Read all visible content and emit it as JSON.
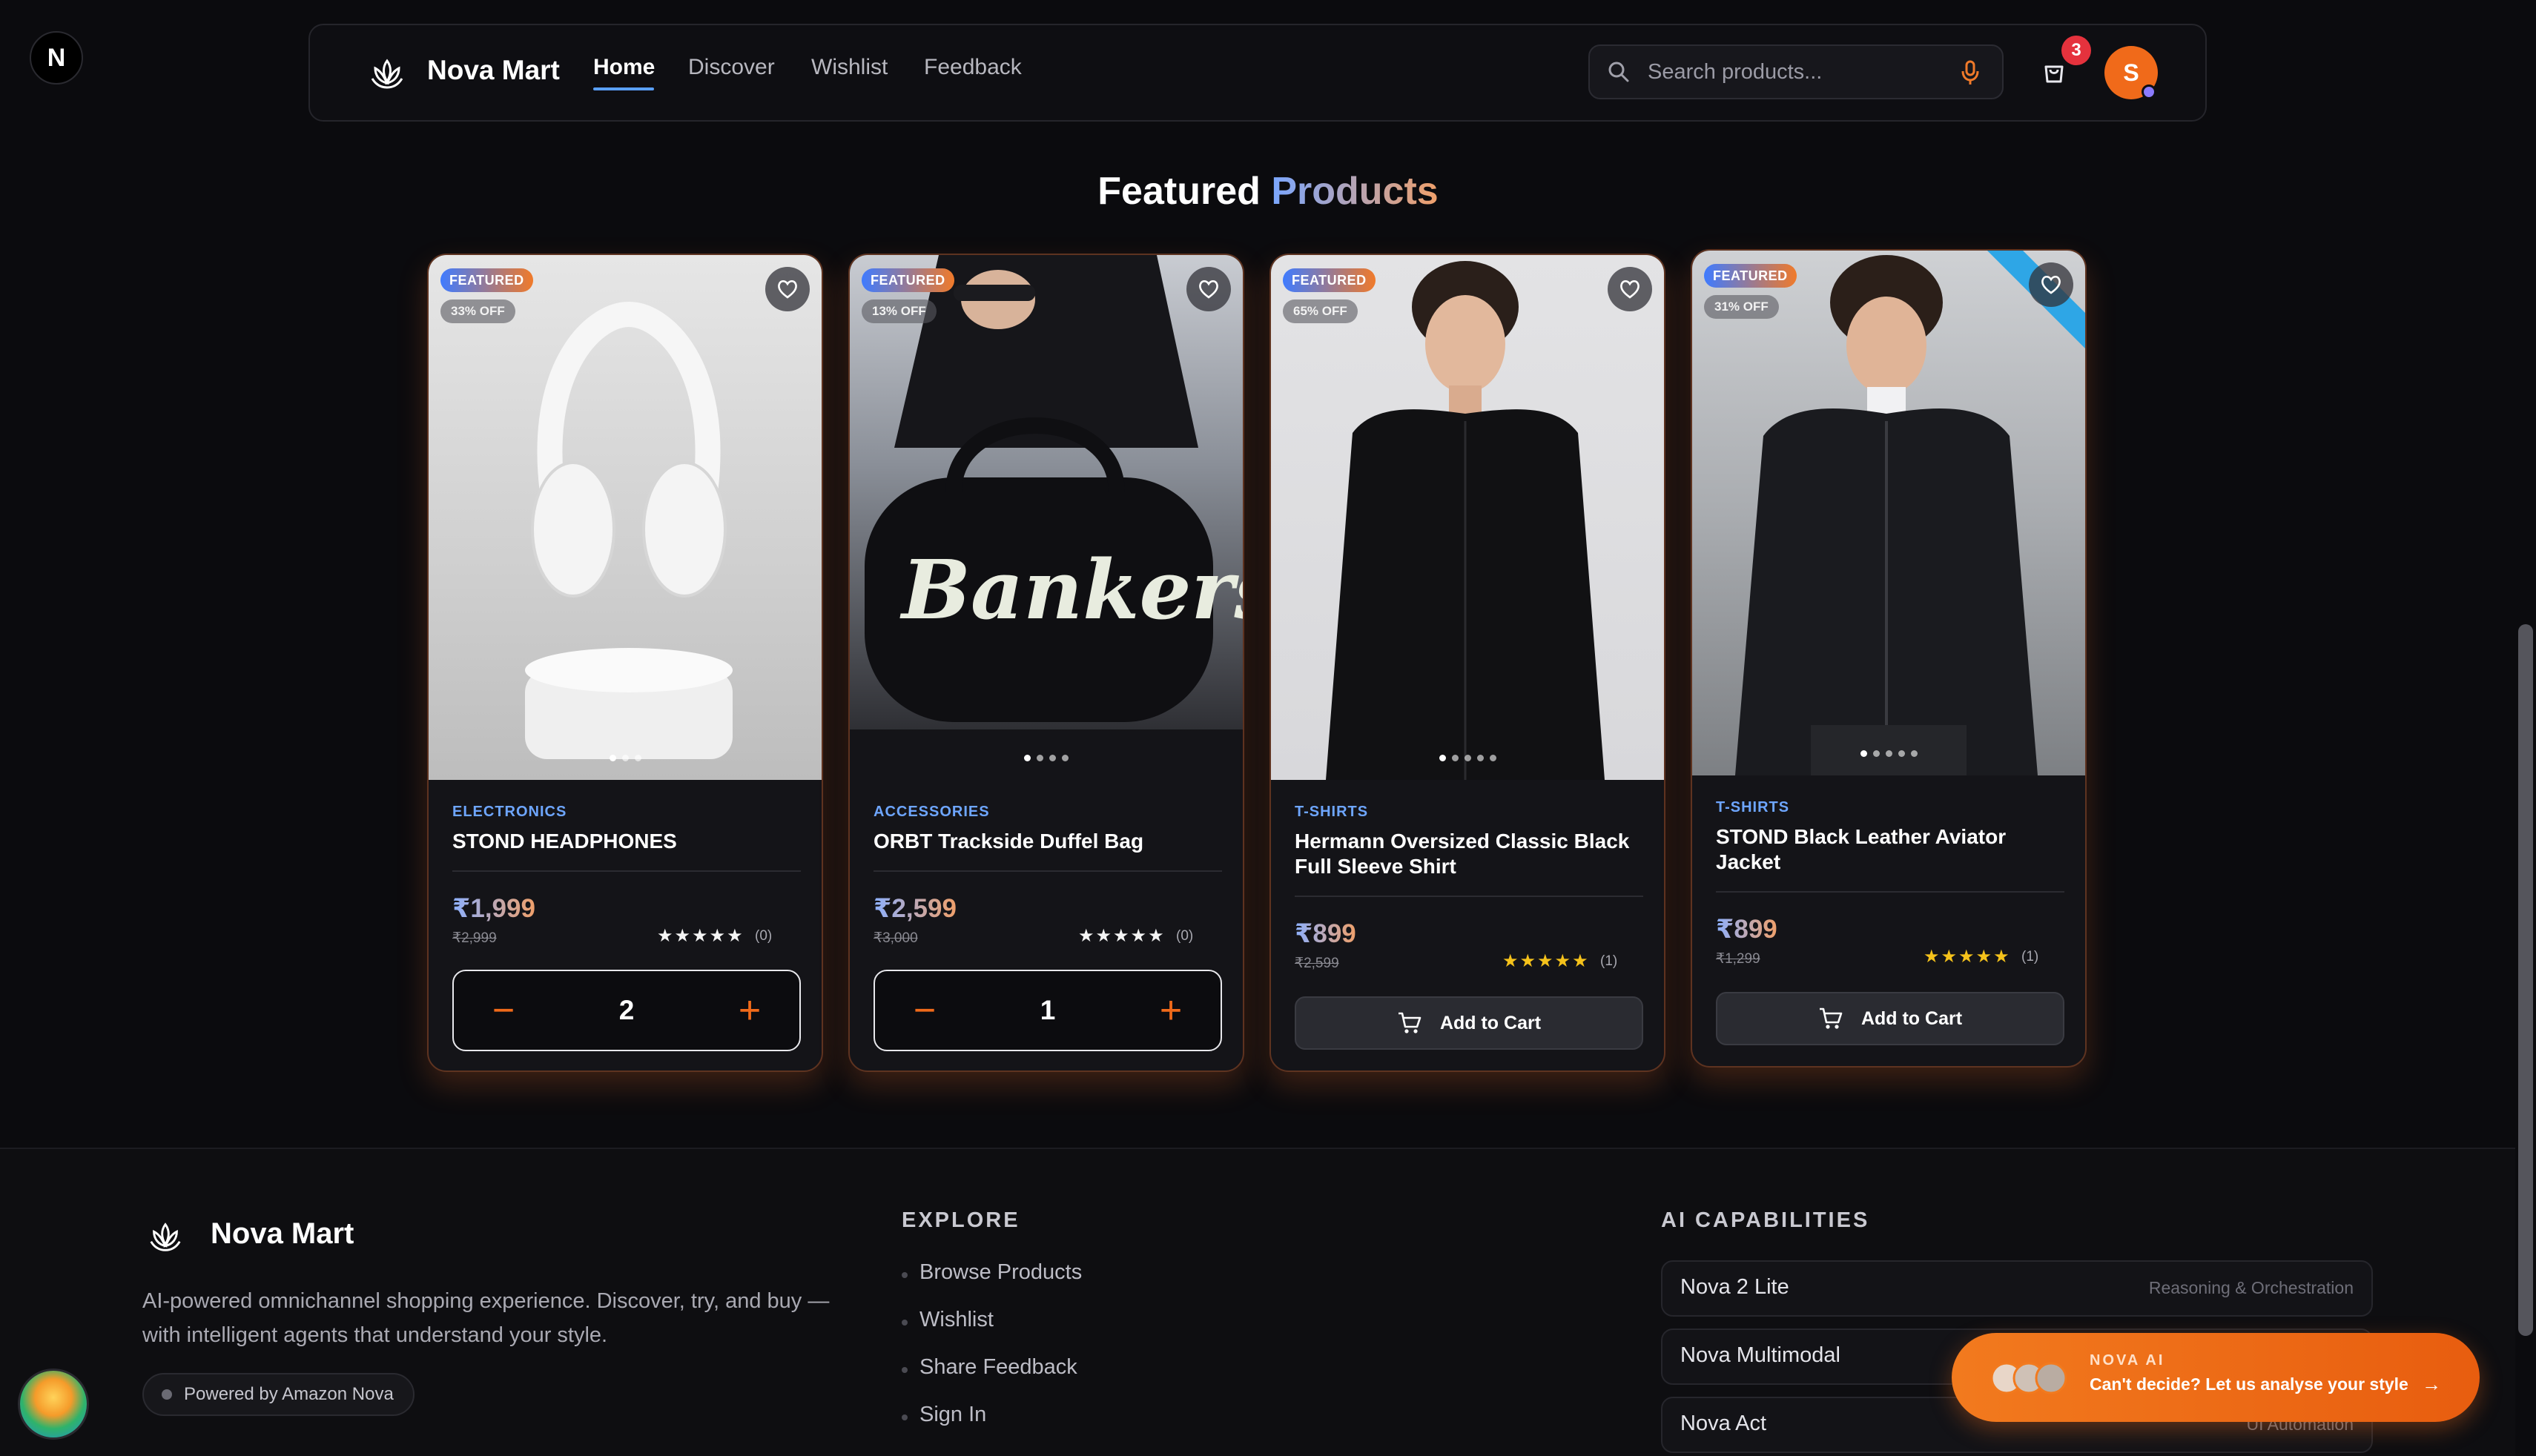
{
  "app": {
    "corner_badge": "N"
  },
  "nav": {
    "brand": "Nova Mart",
    "links": [
      {
        "label": "Home",
        "active": true
      },
      {
        "label": "Discover",
        "active": false
      },
      {
        "label": "Wishlist",
        "active": false
      },
      {
        "label": "Feedback",
        "active": false
      }
    ],
    "search_placeholder": "Search products...",
    "cart_count": "3",
    "user_initial": "S",
    "accent": "#5aa0ff"
  },
  "section": {
    "title_part1": "Featured",
    "title_part2": "Products"
  },
  "products": [
    {
      "badge": "FEATURED",
      "discount": "33% OFF",
      "category": "ELECTRONICS",
      "name": "STOND HEADPHONES",
      "price": "₹1,999",
      "mrp": "₹2,999",
      "stars": "★★★★★",
      "rating_count": "(0)",
      "quantity": "2",
      "image_dots": 3,
      "image": "headphones"
    },
    {
      "badge": "FEATURED",
      "discount": "13% OFF",
      "category": "ACCESSORIES",
      "name": "ORBT Trackside Duffel Bag",
      "price": "₹2,599",
      "mrp": "₹3,000",
      "stars": "★★★★★",
      "rating_count": "(0)",
      "quantity": "1",
      "image_dots": 4,
      "image": "bag"
    },
    {
      "badge": "FEATURED",
      "discount": "65% OFF",
      "category": "T-SHIRTS",
      "name": "Hermann Oversized Classic Black Full Sleeve Shirt",
      "price": "₹899",
      "mrp": "₹2,599",
      "stars": "★★★★★",
      "rating_count": "(1)",
      "add_to_cart": "Add to Cart",
      "image_dots": 5,
      "image": "shirt"
    },
    {
      "badge": "FEATURED",
      "discount": "31% OFF",
      "category": "T-SHIRTS",
      "name": "STOND Black Leather Aviator Jacket",
      "price": "₹899",
      "mrp": "₹1,299",
      "stars": "★★★★★",
      "rating_count": "(1)",
      "add_to_cart": "Add to Cart",
      "image_dots": 5,
      "image": "jacket"
    }
  ],
  "footer": {
    "brand": "Nova Mart",
    "description": "AI-powered omnichannel shopping experience. Discover, try, and buy — with intelligent agents that understand your style.",
    "powered_by": "Powered by Amazon Nova",
    "explore_heading": "EXPLORE",
    "explore_links": [
      "Browse Products",
      "Wishlist",
      "Share Feedback",
      "Sign In"
    ],
    "ai_heading": "AI CAPABILITIES",
    "capabilities": [
      {
        "name": "Nova 2 Lite",
        "desc": "Reasoning & Orchestration"
      },
      {
        "name": "Nova Multimodal",
        "desc": ""
      },
      {
        "name": "Nova Act",
        "desc": "UI Automation"
      }
    ]
  },
  "nova_ai": {
    "label": "NOVA AI",
    "cta": "Can't decide? Let us analyse your style",
    "arrow": "→"
  }
}
